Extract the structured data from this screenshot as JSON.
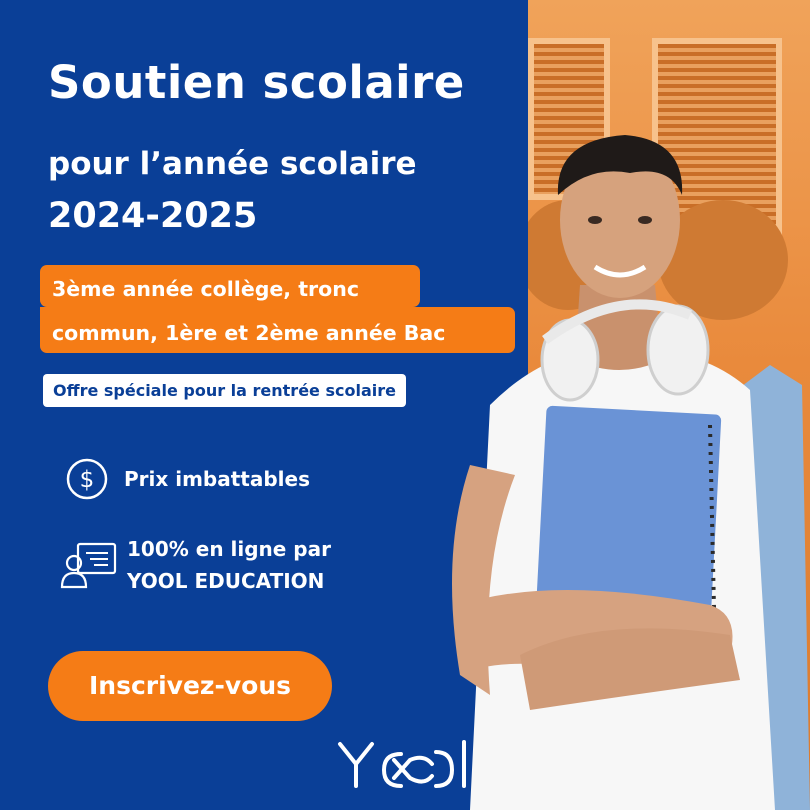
{
  "hero": {
    "title": "Soutien scolaire",
    "subtitle_line1": "pour l’année scolaire",
    "subtitle_line2": "2024-2025"
  },
  "levels": {
    "line1": "3ème année collège, tronc",
    "line2": "commun, 1ère et 2ème année Bac"
  },
  "offer": "Offre spéciale pour la rentrée scolaire",
  "features": {
    "price": "Prix imbattables",
    "online_line1": "100% en ligne par",
    "online_line2": "YOOL EDUCATION"
  },
  "cta": "Inscrivez-vous",
  "brand": {
    "name": "YOOL",
    "colors": {
      "blue": "#0a3f97",
      "orange": "#f57c16",
      "white": "#ffffff"
    }
  },
  "icons": [
    "dollar-circle-icon",
    "online-class-icon"
  ]
}
